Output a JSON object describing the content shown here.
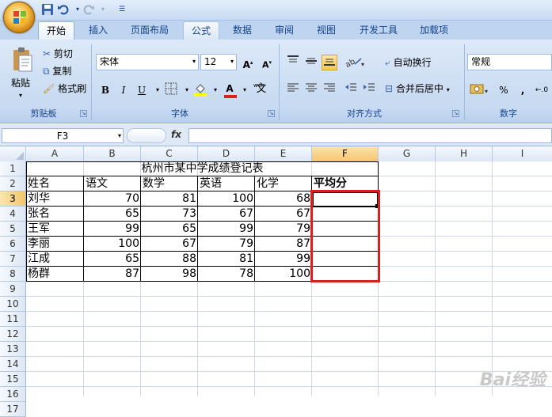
{
  "ribbon": {
    "tabs": [
      "开始",
      "插入",
      "页面布局",
      "公式",
      "数据",
      "审阅",
      "视图",
      "开发工具",
      "加载项"
    ],
    "active_tab_index": 0,
    "hover_tab_index": 3,
    "clipboard": {
      "paste": "粘贴",
      "cut": "剪切",
      "copy": "复制",
      "format_painter": "格式刷",
      "label": "剪贴板"
    },
    "font": {
      "name": "宋体",
      "size": "12",
      "label": "字体",
      "bold": "B",
      "italic": "I",
      "underline": "U",
      "phonetic": "wén"
    },
    "alignment": {
      "wrap": "自动换行",
      "merge": "合并后居中",
      "label": "对齐方式"
    },
    "number": {
      "format": "常规",
      "label": "数字"
    }
  },
  "formula_bar": {
    "name_box": "F3",
    "fx": "fx",
    "value": ""
  },
  "columns": [
    "A",
    "B",
    "C",
    "D",
    "E",
    "F",
    "G",
    "H",
    "I"
  ],
  "selected_column": "F",
  "rows": [
    "1",
    "2",
    "3",
    "4",
    "5",
    "6",
    "7",
    "8",
    "9",
    "10",
    "11",
    "12",
    "13",
    "14",
    "15",
    "16",
    "17"
  ],
  "selected_row": "3",
  "sheet": {
    "title": "杭州市某中学成绩登记表",
    "headers": [
      "姓名",
      "语文",
      "数学",
      "英语",
      "化学",
      "平均分"
    ],
    "records": [
      {
        "name": "刘华",
        "chinese": "70",
        "math": "81",
        "english": "100",
        "chem": "68"
      },
      {
        "name": "张名",
        "chinese": "65",
        "math": "73",
        "english": "67",
        "chem": "67"
      },
      {
        "name": "王军",
        "chinese": "99",
        "math": "65",
        "english": "99",
        "chem": "79"
      },
      {
        "name": "李丽",
        "chinese": "100",
        "math": "67",
        "english": "79",
        "chem": "87"
      },
      {
        "name": "江成",
        "chinese": "65",
        "math": "88",
        "english": "81",
        "chem": "99"
      },
      {
        "name": "杨群",
        "chinese": "87",
        "math": "98",
        "english": "78",
        "chem": "100"
      }
    ]
  },
  "highlight_color": "#dd1e1e",
  "watermark": "Bai经验"
}
